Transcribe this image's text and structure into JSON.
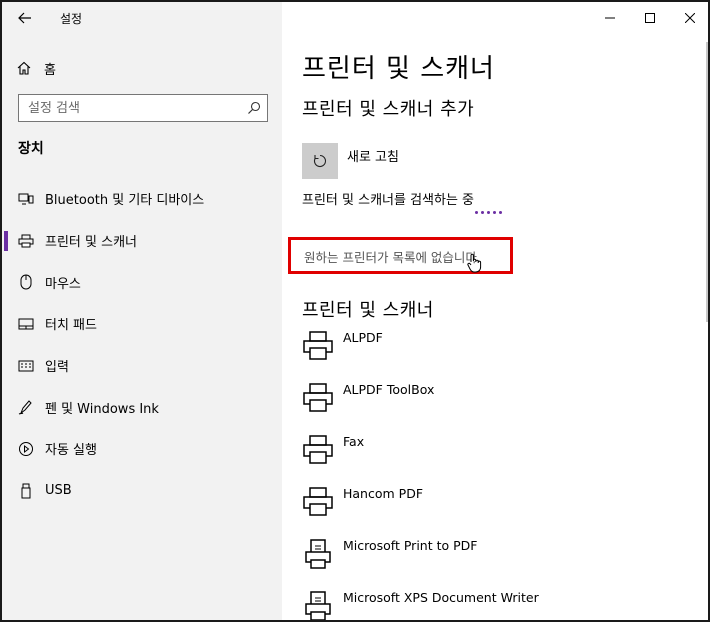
{
  "app": {
    "title": "설정"
  },
  "sidebar": {
    "home_label": "홈",
    "search_placeholder": "설정 검색",
    "section_label": "장치",
    "items": [
      {
        "label": "Bluetooth 및 기타 디바이스",
        "icon": "bluetooth-devices-icon"
      },
      {
        "label": "프린터 및 스캐너",
        "icon": "printer-icon",
        "selected": true
      },
      {
        "label": "마우스",
        "icon": "mouse-icon"
      },
      {
        "label": "터치 패드",
        "icon": "touchpad-icon"
      },
      {
        "label": "입력",
        "icon": "keyboard-icon"
      },
      {
        "label": "펜 및 Windows Ink",
        "icon": "pen-icon"
      },
      {
        "label": "자동 실행",
        "icon": "autoplay-icon"
      },
      {
        "label": "USB",
        "icon": "usb-icon"
      }
    ]
  },
  "main": {
    "page_title": "프린터 및 스캐너",
    "add_heading": "프린터 및 스캐너 추가",
    "refresh_label": "새로 고침",
    "searching_text": "프린터 및 스캐너를 검색하는 중",
    "not_listed_link": "원하는 프린터가 목록에 없습니다.",
    "printers_heading": "프린터 및 스캐너",
    "printers": [
      {
        "name": "ALPDF",
        "icon": "printer-icon"
      },
      {
        "name": "ALPDF ToolBox",
        "icon": "printer-icon"
      },
      {
        "name": "Fax",
        "icon": "printer-icon"
      },
      {
        "name": "Hancom PDF",
        "icon": "printer-icon"
      },
      {
        "name": "Microsoft Print to PDF",
        "icon": "pdf-printer-icon"
      },
      {
        "name": "Microsoft XPS Document Writer",
        "icon": "pdf-printer-icon"
      }
    ]
  },
  "colors": {
    "accent": "#6b2fa3",
    "highlight_box": "#e00000",
    "sidebar_bg": "#f2f2f2"
  }
}
